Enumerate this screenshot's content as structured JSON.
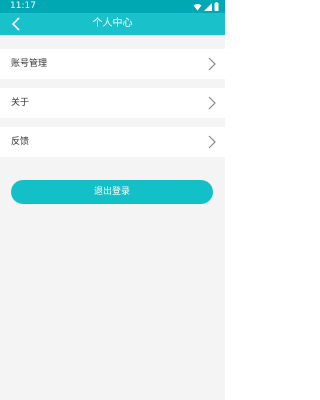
{
  "status_bar": {
    "time": "11:17"
  },
  "header": {
    "title": "个人中心"
  },
  "menu": {
    "items": [
      {
        "label": "账号管理"
      },
      {
        "label": "关于"
      },
      {
        "label": "反馈"
      }
    ]
  },
  "logout": {
    "label": "退出登录"
  },
  "colors": {
    "status_bar": "#00a8b4",
    "header": "#19c1cb",
    "background": "#f4f4f4",
    "button": "#13c0c8"
  }
}
